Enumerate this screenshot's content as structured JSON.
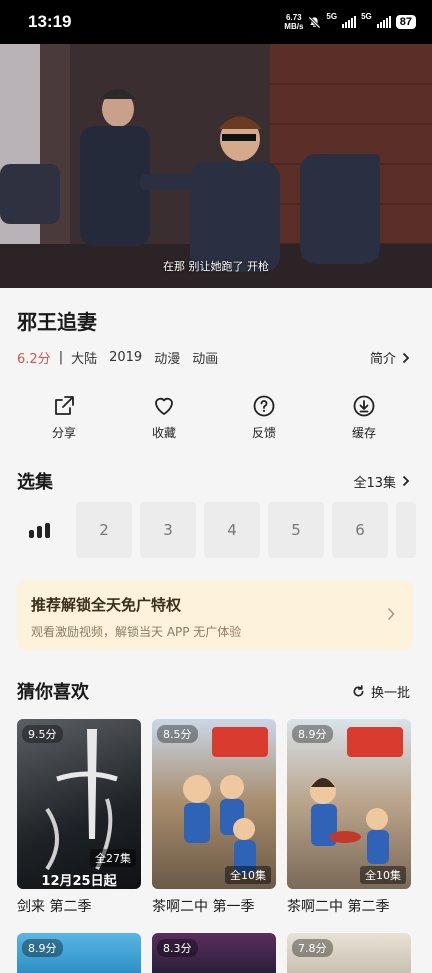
{
  "status_bar": {
    "time": "13:19",
    "net_speed_value": "6.73",
    "net_speed_unit": "MB/s",
    "sim1": "5G",
    "sim2": "5G",
    "battery": "87"
  },
  "video": {
    "subtitle": "在那 别让她跑了 开枪"
  },
  "show": {
    "title": "邪王追妻",
    "score": "6.2分",
    "separator": "|",
    "region": "大陆",
    "year": "2019",
    "tags": [
      "动漫",
      "动画"
    ],
    "intro_label": "简介"
  },
  "actions": [
    {
      "label": "分享",
      "icon": "share-icon"
    },
    {
      "label": "收藏",
      "icon": "heart-icon"
    },
    {
      "label": "反馈",
      "icon": "question-icon"
    },
    {
      "label": "缓存",
      "icon": "download-icon"
    }
  ],
  "episodes": {
    "heading": "选集",
    "total_label": "全13集",
    "items": [
      "2",
      "3",
      "4",
      "5",
      "6"
    ]
  },
  "promo": {
    "title": "推荐解锁全天免广特权",
    "subtitle": "观看激励视频，解锁当天 APP 无广体验"
  },
  "recommend": {
    "heading": "猜你喜欢",
    "refresh_label": "换一批",
    "cards": [
      {
        "title": "剑来 第二季",
        "score": "9.5分",
        "episodes": "全27集",
        "date": "12月25日起",
        "color": "#2b2f33"
      },
      {
        "title": "茶啊二中 第一季",
        "score": "8.5分",
        "episodes": "全10集",
        "color": "#7f6a52"
      },
      {
        "title": "茶啊二中 第二季",
        "score": "8.9分",
        "episodes": "全10集",
        "color": "#8d7a62"
      }
    ],
    "more_cards": [
      {
        "score": "8.9分",
        "color": "#3aa2d8"
      },
      {
        "score": "8.3分",
        "color": "#3a2a4a"
      },
      {
        "score": "7.8分",
        "color": "#d9d2c6"
      }
    ]
  }
}
